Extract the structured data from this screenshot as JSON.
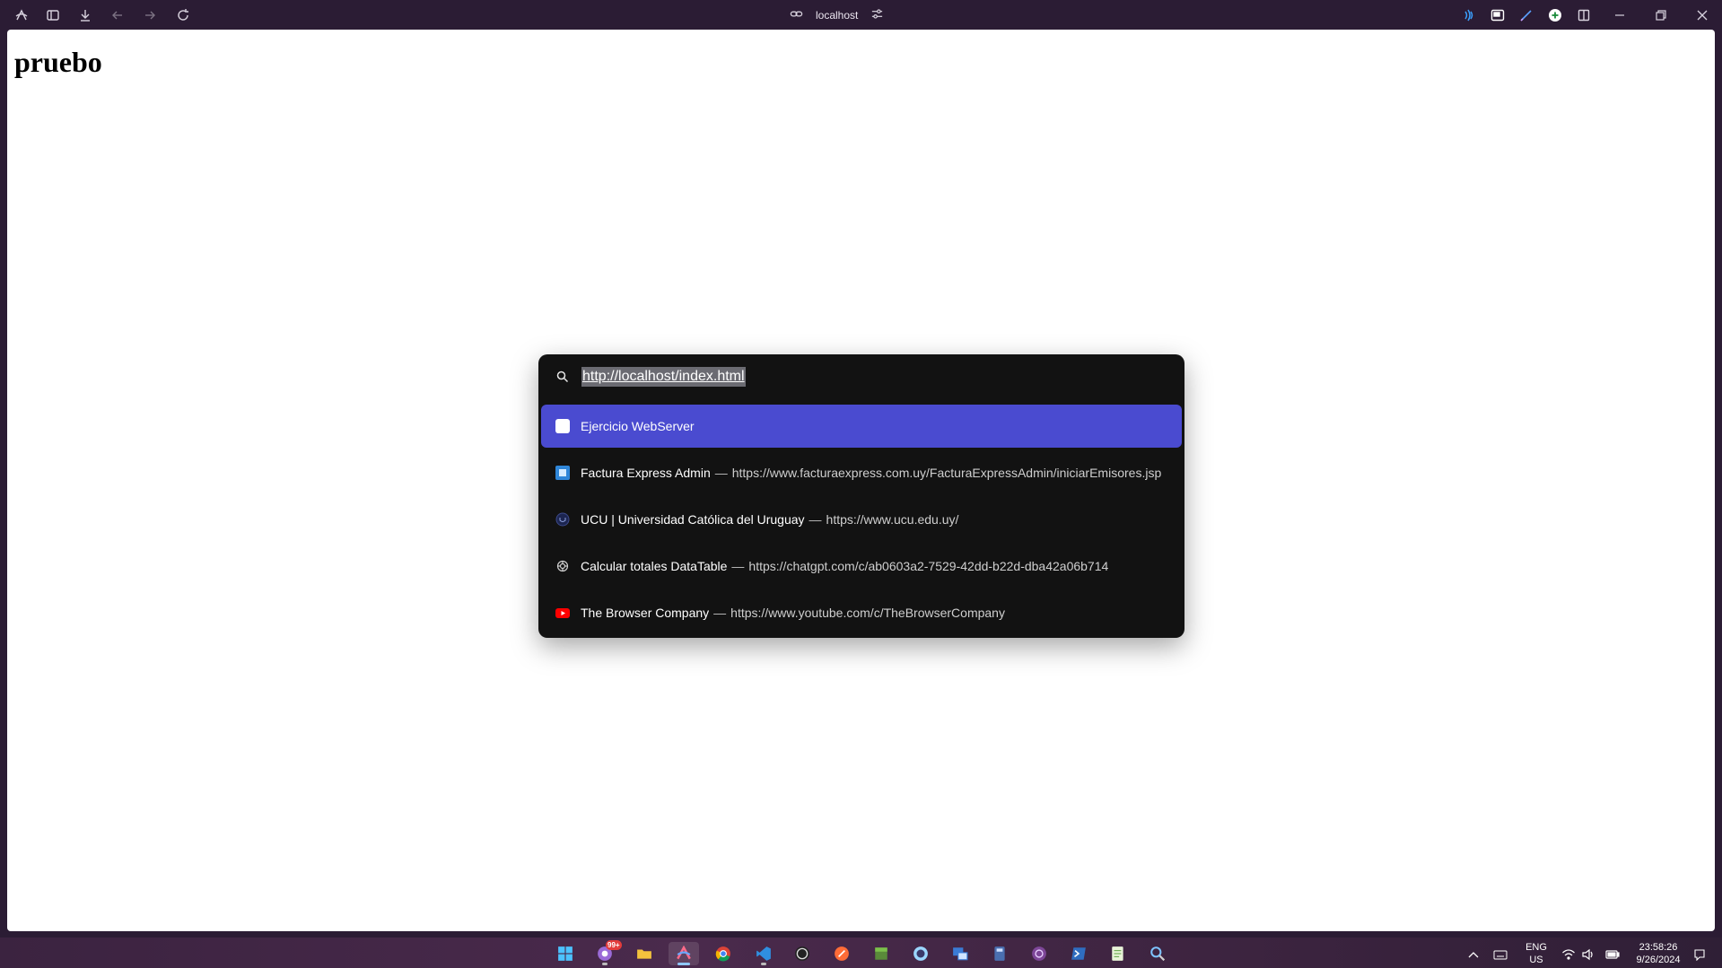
{
  "browser": {
    "url_display": "localhost",
    "toolbar_icons": [
      "arc-logo-icon",
      "sidebar-toggle-icon",
      "download-icon",
      "back-arrow-icon",
      "forward-arrow-icon",
      "reload-icon"
    ],
    "right_icons": [
      "audio-wave-icon",
      "picture-in-picture-icon",
      "pen-icon",
      "add-circle-icon",
      "split-view-icon",
      "minimize-icon",
      "restore-icon",
      "close-icon"
    ]
  },
  "page": {
    "heading": "pruebo"
  },
  "command_bar": {
    "query": "http://localhost/index.html",
    "selected_index": 0,
    "results": [
      {
        "title": "Ejercicio WebServer",
        "separator": "",
        "url": "",
        "icon": "blank-page-icon"
      },
      {
        "title": "Factura Express Admin",
        "separator": "—",
        "url": "https://www.facturaexpress.com.uy/FacturaExpressAdmin/iniciarEmisores.jsp",
        "icon": "factura-express-icon"
      },
      {
        "title": "UCU | Universidad Católica del Uruguay",
        "separator": "—",
        "url": "https://www.ucu.edu.uy/",
        "icon": "ucu-icon"
      },
      {
        "title": "Calcular totales DataTable",
        "separator": "—",
        "url": "https://chatgpt.com/c/ab0603a2-7529-42dd-b22d-dba42a06b714",
        "icon": "chatgpt-icon"
      },
      {
        "title": "The Browser Company",
        "separator": "—",
        "url": "https://www.youtube.com/c/TheBrowserCompany",
        "icon": "youtube-icon"
      }
    ]
  },
  "taskbar": {
    "notification_badge": "99+",
    "language_primary": "ENG",
    "language_secondary": "US",
    "time": "23:58:26",
    "date": "9/26/2024",
    "colors": {
      "accent": "#4a4bd0",
      "active_indicator": "#8fc7ff"
    }
  }
}
